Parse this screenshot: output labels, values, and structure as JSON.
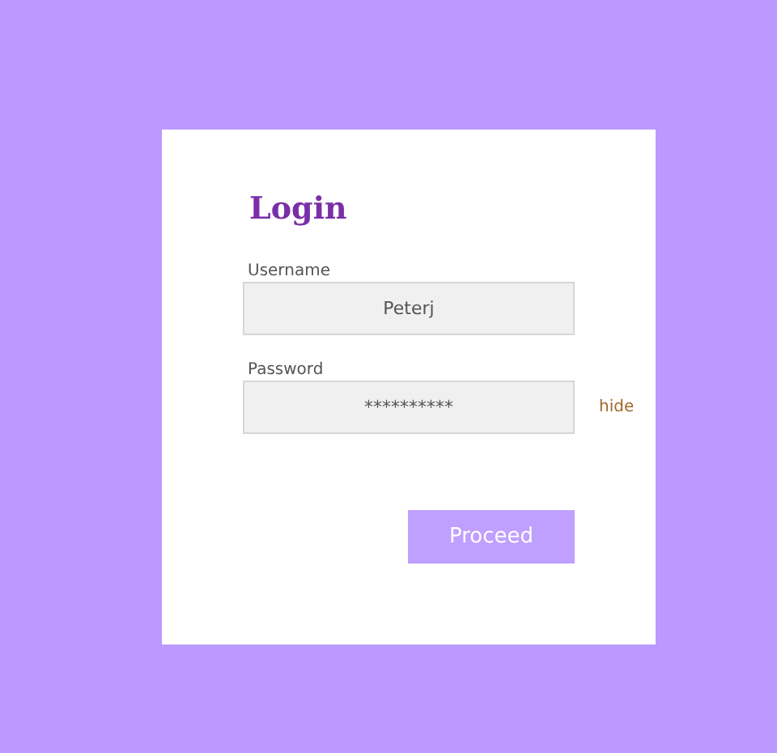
{
  "title": "Login",
  "fields": [
    {
      "label": "Username",
      "value": "Peterj"
    },
    {
      "label": "Password",
      "value": "**********",
      "toggle": "hide"
    }
  ],
  "button": "Proceed"
}
